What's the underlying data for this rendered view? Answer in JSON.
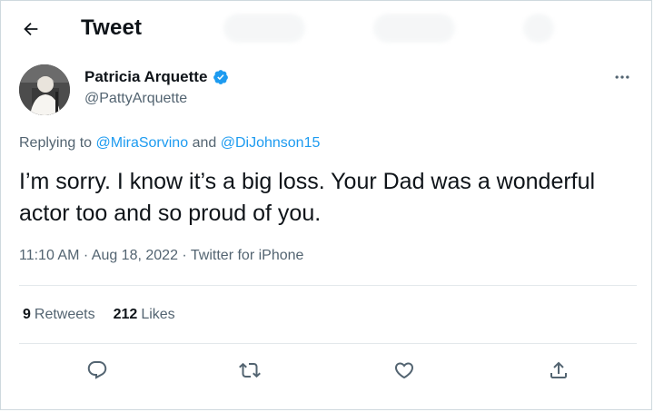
{
  "header": {
    "title": "Tweet"
  },
  "tweet": {
    "author_name": "Patricia Arquette",
    "author_handle": "@PattyArquette",
    "replying_prefix": "Replying to",
    "reply_mention_1": "@MiraSorvino",
    "reply_conjunction": "and",
    "reply_mention_2": "@DiJohnson15",
    "text": "I’m sorry. I know it’s a big loss. Your Dad was a wonderful actor too and so proud of you.",
    "time": "11:10 AM",
    "separator": "·",
    "date": "Aug 18, 2022",
    "source": "Twitter for iPhone"
  },
  "stats": {
    "retweets_count": "9",
    "retweets_label": "Retweets",
    "likes_count": "212",
    "likes_label": "Likes"
  },
  "icons": {
    "back": "arrow-left-icon",
    "verified": "verified-badge-icon",
    "more": "more-icon",
    "reply": "reply-icon",
    "retweet": "retweet-icon",
    "like": "heart-icon",
    "share": "share-icon"
  },
  "colors": {
    "accent": "#1d9bf0",
    "text": "#0f1419",
    "secondary": "#536471"
  }
}
